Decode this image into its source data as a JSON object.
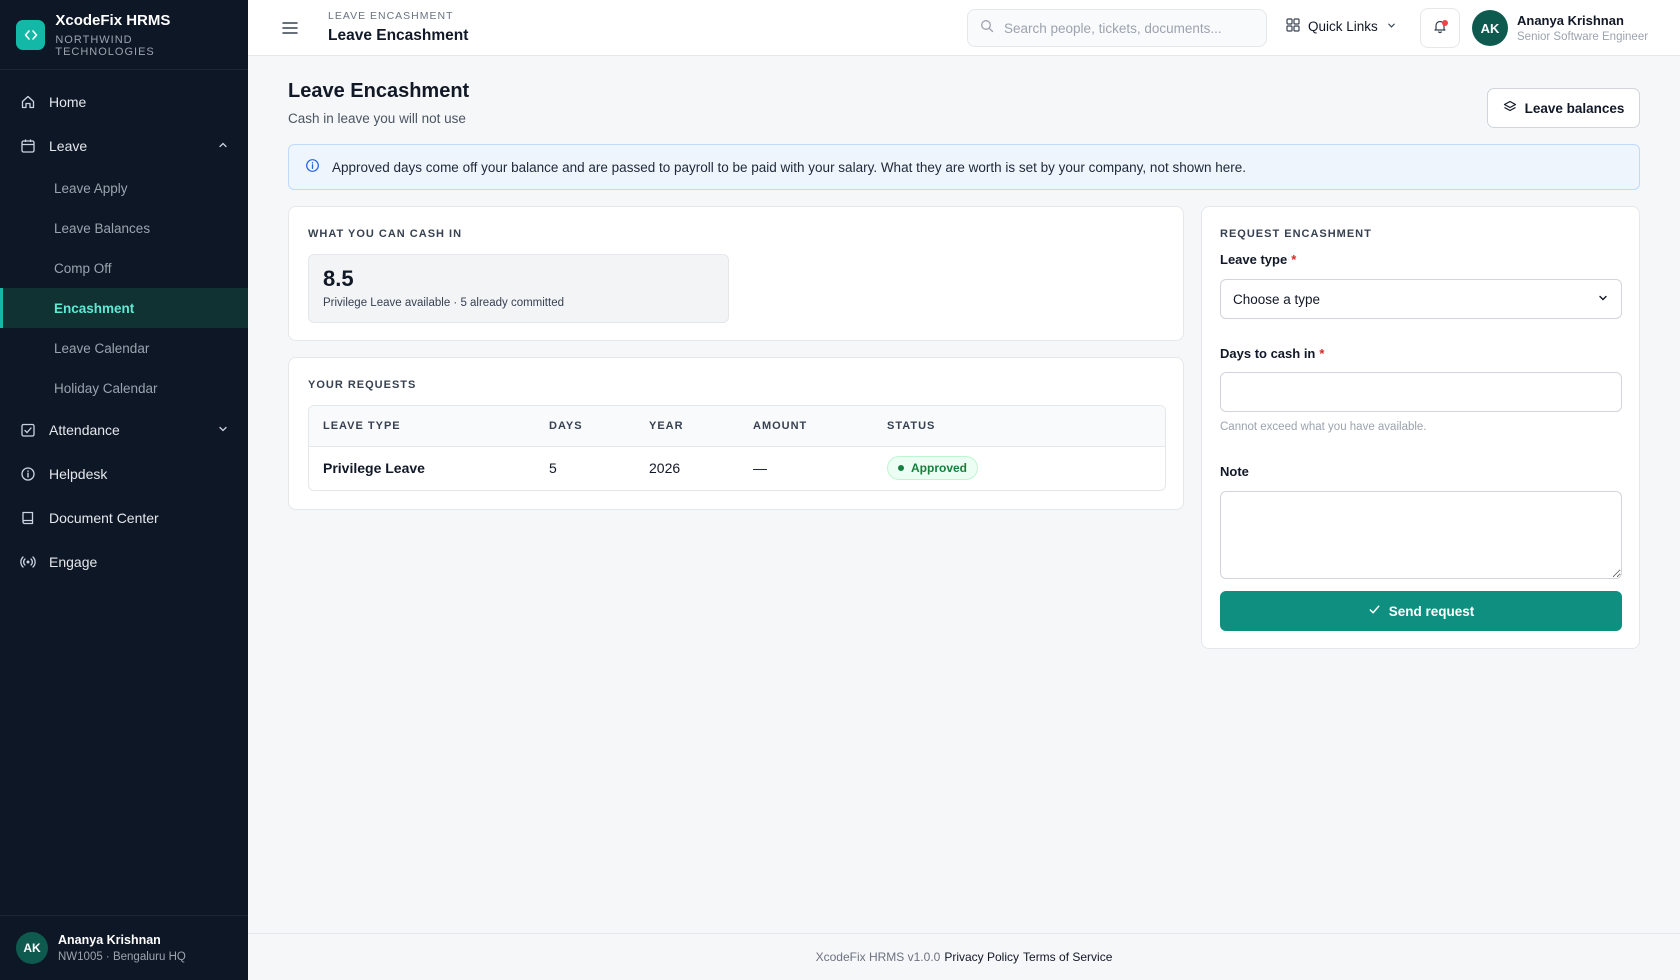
{
  "brand": {
    "name": "XcodeFix HRMS",
    "org": "NORTHWIND TECHNOLOGIES",
    "accent": "#14b8a6"
  },
  "sidebar": {
    "items": [
      {
        "label": "Home",
        "icon": "home-icon"
      },
      {
        "label": "Leave",
        "icon": "calendar-icon",
        "expanded": true,
        "children": [
          "Leave Apply",
          "Leave Balances",
          "Comp Off",
          "Encashment",
          "Leave Calendar",
          "Holiday Calendar"
        ],
        "active_child": "Encashment"
      },
      {
        "label": "Attendance",
        "icon": "calendar-check-icon",
        "expanded": false
      },
      {
        "label": "Helpdesk",
        "icon": "info-circle-icon"
      },
      {
        "label": "Document Center",
        "icon": "book-icon"
      },
      {
        "label": "Engage",
        "icon": "broadcast-icon"
      }
    ],
    "user": {
      "initials": "AK",
      "name": "Ananya Krishnan",
      "meta": "NW1005 · Bengaluru HQ"
    }
  },
  "header": {
    "crumb": "LEAVE ENCASHMENT",
    "title": "Leave Encashment",
    "search_placeholder": "Search people, tickets, documents...",
    "quick_links": "Quick Links",
    "user": {
      "initials": "AK",
      "name": "Ananya Krishnan",
      "role": "Senior Software Engineer"
    }
  },
  "page": {
    "title": "Leave Encashment",
    "subtitle": "Cash in leave you will not use",
    "balances_button": "Leave balances",
    "notice": "Approved days come off your balance and are passed to payroll to be paid with your salary. What they are worth is set by your company, not shown here."
  },
  "cash_in": {
    "label": "WHAT YOU CAN CASH IN",
    "value": "8.5",
    "description": "Privilege Leave available · 5 already committed"
  },
  "requests": {
    "label": "YOUR REQUESTS",
    "columns": [
      "LEAVE TYPE",
      "DAYS",
      "YEAR",
      "AMOUNT",
      "STATUS"
    ],
    "rows": [
      {
        "leave_type": "Privilege Leave",
        "days": "5",
        "year": "2026",
        "amount": "—",
        "status": "Approved"
      }
    ]
  },
  "form": {
    "label": "REQUEST ENCASHMENT",
    "leave_type_label": "Leave type",
    "leave_type_value": "Choose a type",
    "days_label": "Days to cash in",
    "days_value": "",
    "days_hint": "Cannot exceed what you have available.",
    "note_label": "Note",
    "note_value": "",
    "required_mark": "*",
    "submit": "Send request"
  },
  "footer": {
    "version": "XcodeFix HRMS v1.0.0",
    "privacy": "Privacy Policy",
    "terms": "Terms of Service"
  }
}
